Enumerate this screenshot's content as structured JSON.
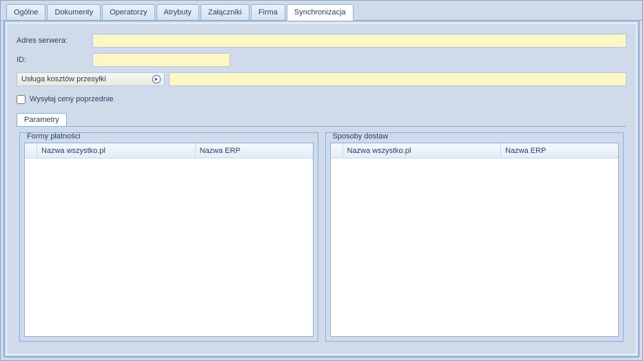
{
  "tabs": {
    "items": [
      {
        "label": "Ogólne",
        "active": false
      },
      {
        "label": "Dokumenty",
        "active": false
      },
      {
        "label": "Operatorzy",
        "active": false
      },
      {
        "label": "Atrybuty",
        "active": false
      },
      {
        "label": "Załączniki",
        "active": false
      },
      {
        "label": "Firma",
        "active": false
      },
      {
        "label": "Synchronizacja",
        "active": true
      }
    ]
  },
  "form": {
    "server_address_label": "Adres serwera:",
    "server_address_value": "",
    "id_label": "ID:",
    "id_value": "",
    "shipping_cost_lookup_label": "Usługa kosztów przesyłki",
    "shipping_cost_value": "",
    "send_previous_prices_label": "Wysyłaj ceny poprzednie",
    "send_previous_prices_checked": false
  },
  "inner_tabs": {
    "items": [
      {
        "label": "Parametry",
        "active": true
      }
    ]
  },
  "groups": {
    "payments": {
      "title": "Formy płatności",
      "columns": {
        "col1": "Nazwa wszystko.pl",
        "col2": "Nazwa ERP"
      },
      "rows": []
    },
    "deliveries": {
      "title": "Sposoby dostaw",
      "columns": {
        "col1": "Nazwa wszystko.pl",
        "col2": "Nazwa ERP"
      },
      "rows": []
    }
  }
}
